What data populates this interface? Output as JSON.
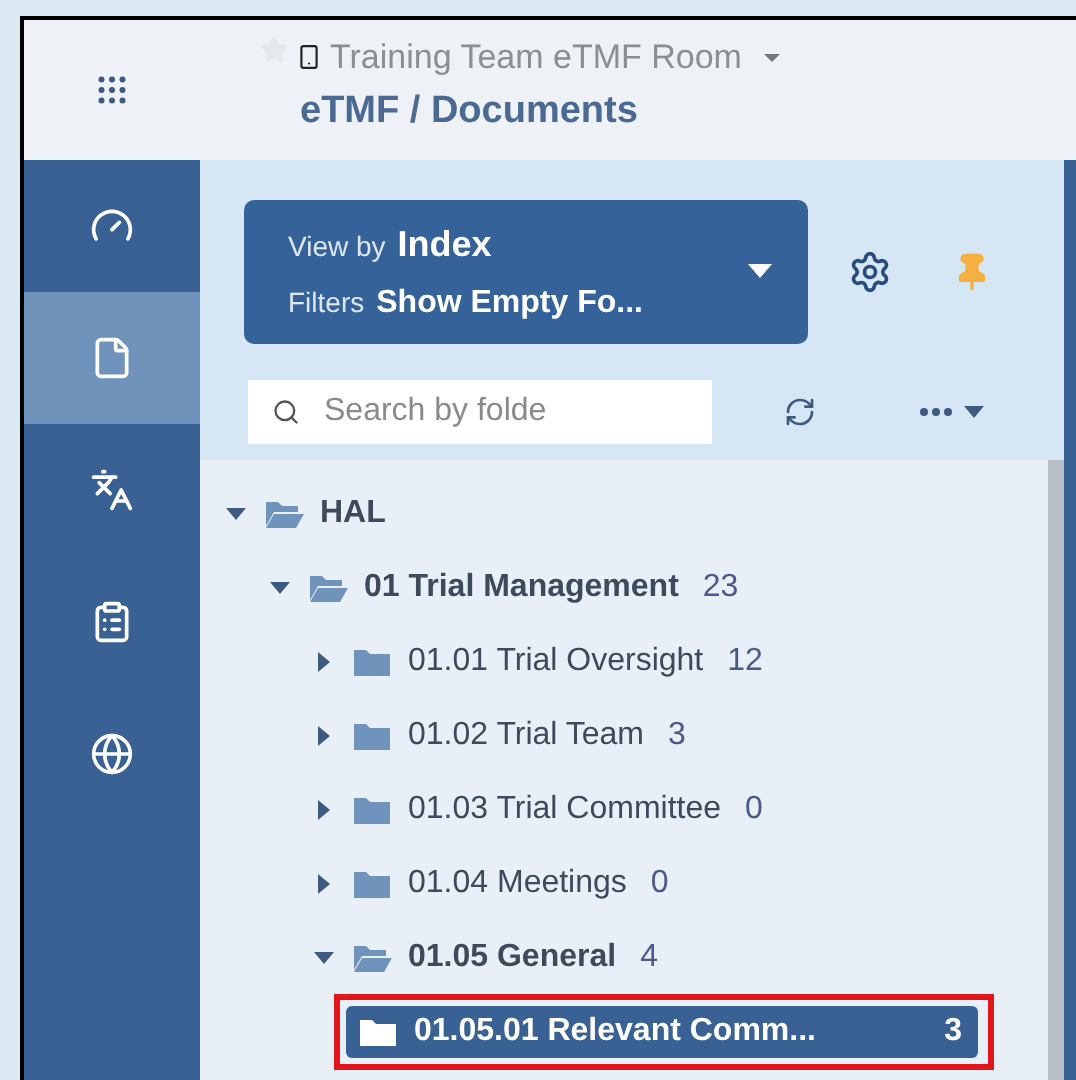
{
  "header": {
    "room_title": "Training Team eTMF Room",
    "favorite": false,
    "breadcrumb": "eTMF / Documents"
  },
  "rail": {
    "items": [
      {
        "kind": "dashboard",
        "selected": false
      },
      {
        "kind": "documents",
        "selected": true
      },
      {
        "kind": "translate",
        "selected": false
      },
      {
        "kind": "clipboard",
        "selected": false
      },
      {
        "kind": "globe",
        "selected": false
      }
    ]
  },
  "view_selector": {
    "view_label": "View by",
    "view_value": "Index",
    "filters_label": "Filters",
    "filters_value": "Show Empty Fo..."
  },
  "search": {
    "placeholder": "Search by folde"
  },
  "tree": [
    {
      "label": "HAL",
      "expandable": true,
      "expanded": true,
      "selected": false,
      "children": [
        {
          "label": "01 Trial Management",
          "count": "23",
          "expandable": true,
          "expanded": true,
          "selected": false,
          "children": [
            {
              "label": "01.01 Trial Oversight",
              "count": "12",
              "expandable": true,
              "expanded": false,
              "selected": false
            },
            {
              "label": "01.02 Trial Team",
              "count": "3",
              "expandable": true,
              "expanded": false,
              "selected": false
            },
            {
              "label": "01.03 Trial Committee",
              "count": "0",
              "expandable": true,
              "expanded": false,
              "selected": false
            },
            {
              "label": "01.04 Meetings",
              "count": "0",
              "expandable": true,
              "expanded": false,
              "selected": false
            },
            {
              "label": "01.05 General",
              "count": "4",
              "expandable": true,
              "expanded": true,
              "selected": false,
              "children": [
                {
                  "label": "01.05.01 Relevant Comm...",
                  "count": "3",
                  "selected": true,
                  "highlighted": true
                }
              ]
            }
          ]
        }
      ]
    }
  ]
}
